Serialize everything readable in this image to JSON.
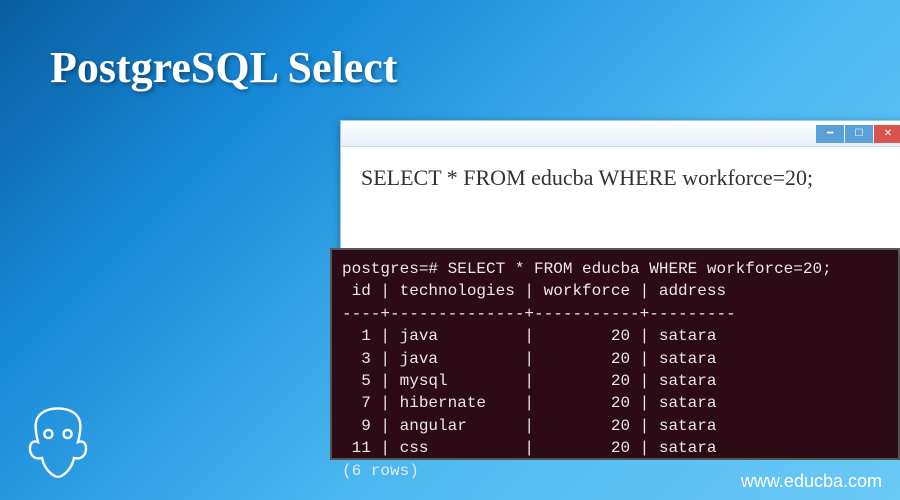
{
  "title": "PostgreSQL Select",
  "window": {
    "query": "SELECT * FROM educba WHERE workforce=20;"
  },
  "terminal": {
    "prompt": "postgres=# ",
    "query": "SELECT * FROM educba WHERE workforce=20;",
    "headers": " id | technologies | workforce | address",
    "separator": "----+--------------+-----------+---------",
    "rows": [
      "  1 | java         |        20 | satara",
      "  3 | java         |        20 | satara",
      "  5 | mysql        |        20 | satara",
      "  7 | hibernate    |        20 | satara",
      "  9 | angular      |        20 | satara",
      " 11 | css          |        20 | satara"
    ],
    "footer": "(6 rows)"
  },
  "watermark": "www.educba.com",
  "win_buttons": {
    "min": "━",
    "max": "☐",
    "close": "✕"
  }
}
